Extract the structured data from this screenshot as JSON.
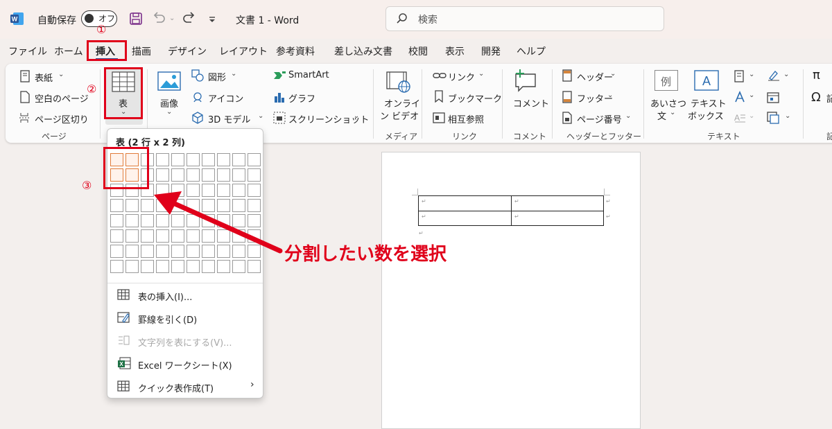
{
  "titlebar": {
    "autosave_label": "自動保存",
    "autosave_state": "オフ",
    "doc_title": "文書 1  -  Word",
    "search_placeholder": "検索"
  },
  "tabs": [
    "ファイル",
    "ホーム",
    "挿入",
    "描画",
    "デザイン",
    "レイアウト",
    "参考資料",
    "差し込み文書",
    "校閲",
    "表示",
    "開発",
    "ヘルプ"
  ],
  "ribbon": {
    "page": {
      "cover": "表紙",
      "blank": "空白のページ",
      "break": "ページ区切り",
      "group": "ページ"
    },
    "table": {
      "label": "表"
    },
    "illust": {
      "images": "画像",
      "shapes": "図形",
      "icons": "アイコン",
      "model3d": "3D モデル",
      "smartart": "SmartArt",
      "chart": "グラフ",
      "screenshot": "スクリーンショット"
    },
    "media": {
      "online_video_1": "オンライ",
      "online_video_2": "ン ビデオ",
      "group": "メディア"
    },
    "links": {
      "link": "リンク",
      "bookmark": "ブックマーク",
      "crossref": "相互参照",
      "group": "リンク"
    },
    "comments": {
      "comment": "コメント",
      "group": "コメント"
    },
    "header_footer": {
      "header": "ヘッダー",
      "footer": "フッター",
      "page_number": "ページ番号",
      "group": "ヘッダーとフッター"
    },
    "text": {
      "greeting_1": "あいさつ",
      "greeting_2": "文",
      "textbox_1": "テキスト",
      "textbox_2": "ボックス",
      "group": "テキスト",
      "sample_glyph": "例"
    },
    "symbols": {
      "eq": "π",
      "sym": "Ω",
      "sym_cut": "記",
      "group_cut": "記"
    }
  },
  "dropdown": {
    "title": "表 (2 行 x 2 列)",
    "grid": {
      "rows": 8,
      "cols": 10,
      "selected_rows": 2,
      "selected_cols": 2
    },
    "items": {
      "insert": "表の挿入(I)...",
      "draw": "罫線を引く(D)",
      "convert": "文字列を表にする(V)...",
      "excel": "Excel ワークシート(X)",
      "quick": "クイック表作成(T)"
    }
  },
  "annotations": {
    "n1": "①",
    "n2": "②",
    "n3": "③",
    "instruction": "分割したい数を選択"
  },
  "document": {
    "paragraph_mark": "↵"
  },
  "colors": {
    "accent_red": "#e0001a",
    "selection_orange": "#e07b39",
    "word_blue": "#2b579a"
  }
}
